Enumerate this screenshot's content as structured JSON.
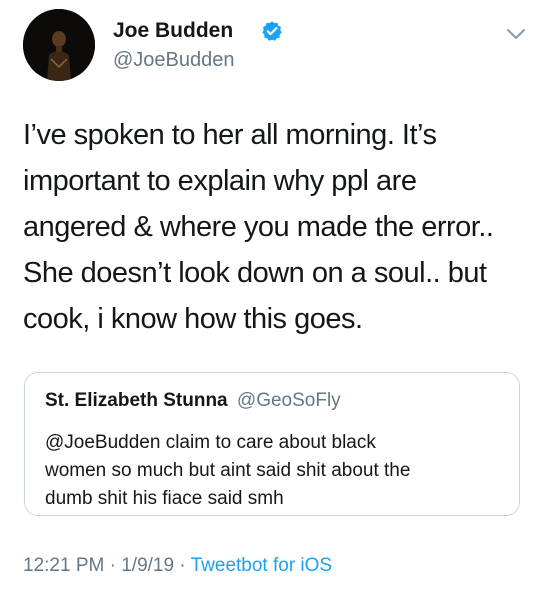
{
  "author": {
    "display_name": "Joe Budden",
    "handle": "@JoeBudden",
    "avatar_icon": "avatar",
    "verified_icon": "verified-badge-icon",
    "verified_color": "#1da1f2"
  },
  "menu_icon": "chevron-down-icon",
  "tweet": {
    "lines": [
      "I’ve spoken to her all morning. It’s",
      "important to explain why ppl are",
      "angered & where you made the error..",
      "She doesn’t look down on a soul.. but",
      "cook, i know how this goes."
    ]
  },
  "quoted_tweet": {
    "display_name": "St. Elizabeth Stunna",
    "handle": "@GeoSoFly",
    "lines": [
      "@JoeBudden claim to care about black",
      "women so much but aint said shit about the",
      "dumb shit his fiace said smh"
    ]
  },
  "meta": {
    "time": "12:21 PM",
    "separator": " · ",
    "date": "1/9/19",
    "source": "Tweetbot for iOS"
  },
  "colors": {
    "text": "#14171a",
    "secondary": "#657786",
    "link": "#1da1f2",
    "border": "#ccd6dd"
  }
}
